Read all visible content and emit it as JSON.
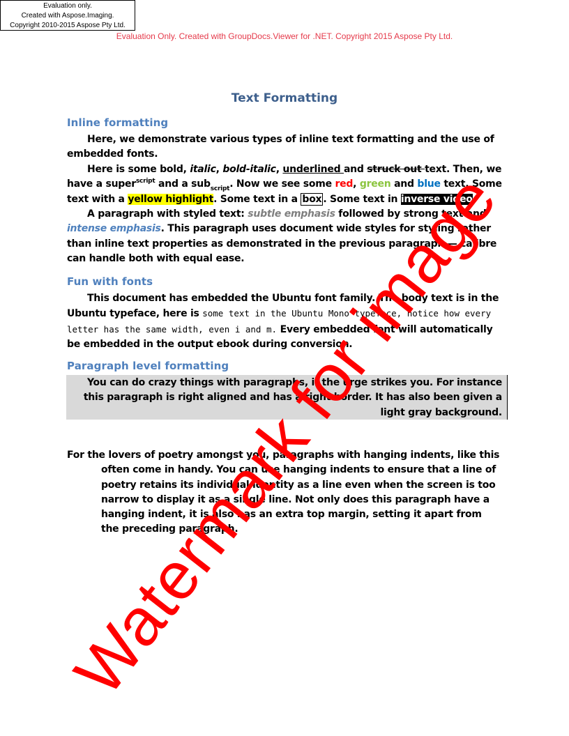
{
  "eval_box": {
    "line1": "Evaluation only.",
    "line2": "Created with Aspose.Imaging.",
    "line3": "Copyright 2010-2015 Aspose Pty  Ltd."
  },
  "eval_banner": "Evaluation Only. Created with GroupDocs.Viewer for .NET. Copyright 2015 Aspose Pty Ltd.",
  "title": "Text Formatting",
  "section_inline": {
    "heading": "Inline formatting",
    "p1": "Here, we demonstrate various types of inline text formatting and the use of embedded fonts.",
    "p2": {
      "t1": "Here is some bold, ",
      "italic": "italic",
      "t2": ", ",
      "bold_italic": "bold-italic",
      "t3": ", ",
      "underlined": "underlined ",
      "t4": " and ",
      "struckout": "struck out ",
      "t5": " text. Then, we have a super",
      "sup": "script",
      "t6": " and a sub",
      "sub": "script",
      "t7": ". Now we see some ",
      "red": "red",
      "t8": ", ",
      "green": "green",
      "t9": " and ",
      "blue": "blue",
      "t10": " text. Some text with a ",
      "highlight": "yellow highlight",
      "t11": ". Some text in a ",
      "box": "box",
      "t12": ". Some text in ",
      "inverse": "inverse video",
      "t13": "."
    },
    "p3": {
      "t1": "A paragraph with styled text: ",
      "subtle": "subtle emphasis",
      "t2": " followed by strong text and ",
      "intense": "intense emphasis",
      "t3": ". This paragraph uses document wide styles for styling rather than inline text properties as demonstrated in the previous paragraph — calibre can handle both with equal ease."
    }
  },
  "section_fonts": {
    "heading": "Fun with fonts",
    "t1": "This document has embedded the Ubuntu font family. The body text is in the Ubuntu typeface, here is ",
    "mono": "some text in the Ubuntu Mono typeface, notice how every letter has the same width, even i and m.",
    "t2": " Every embedded font will automatically be embedded in the output ebook during conversion."
  },
  "section_para": {
    "heading": "Paragraph level formatting",
    "right_aligned": "You can do crazy things with paragraphs, if the urge strikes you. For instance this paragraph is right aligned and has a right border. It has also been given a light gray background.",
    "hanging": "For the lovers of poetry amongst you, paragraphs with hanging indents, like this often come in handy. You can use hanging indents to ensure that a line of poetry retains its individual identity as a line even when the screen is too narrow to display it as a single line. Not only does this paragraph have a hanging indent, it is also has an extra top margin, setting it apart from the preceding paragraph."
  },
  "watermark": "Watermark for image",
  "colors": {
    "title": "#3d5f8c",
    "heading": "#4f80bd",
    "red": "#ff0000",
    "green": "#8cc540",
    "blue": "#0070c0",
    "highlight": "#ffff00",
    "gray_bg": "#d9d9d9",
    "eval_banner": "#e5394a"
  }
}
